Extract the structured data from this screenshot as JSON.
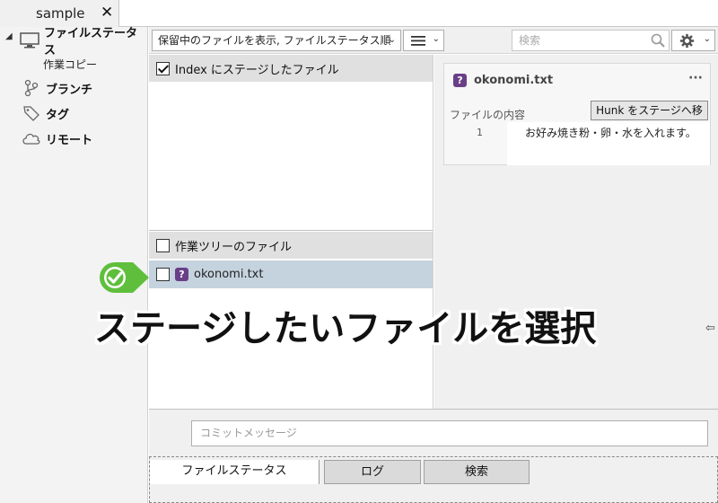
{
  "window": {
    "tab_label": "sample",
    "tab_close_icon": "close-icon"
  },
  "sidebar": {
    "items": [
      {
        "label": "ファイルステータス",
        "icon": "monitor-icon"
      },
      {
        "label": "作業コピー",
        "icon": ""
      },
      {
        "label": "ブランチ",
        "icon": "branch-icon"
      },
      {
        "label": "タグ",
        "icon": "tag-icon"
      },
      {
        "label": "リモート",
        "icon": "cloud-icon"
      }
    ]
  },
  "toolbar": {
    "filter_value": "保留中のファイルを表示, ファイルステータス順",
    "list_icon": "list-icon",
    "search_placeholder": "検索",
    "settings_icon": "gear-icon"
  },
  "staged": {
    "header": "Index にステージしたファイル",
    "header_checked": true
  },
  "working": {
    "header": "作業ツリーのファイル",
    "files": [
      {
        "name": "okonomi.txt",
        "status": "?"
      }
    ]
  },
  "diff": {
    "file_name": "okonomi.txt",
    "status": "?",
    "more_label": "···",
    "content_label": "ファイルの内容",
    "hunk_button": "Hunk をステージへ移動",
    "lines": [
      {
        "num": "1",
        "text": "お好み焼き粉・卵・水を入れます。"
      }
    ]
  },
  "annotation": {
    "text": "ステージしたいファイルを選択",
    "badge_color": "#5fbf3c"
  },
  "commit": {
    "placeholder": "コミットメッセージ"
  },
  "bottom_tabs": [
    "ファイルステータス",
    "ログ",
    "検索"
  ],
  "colors": {
    "selected_row": "#c5d3df",
    "status_badge": "#6a3f88"
  }
}
